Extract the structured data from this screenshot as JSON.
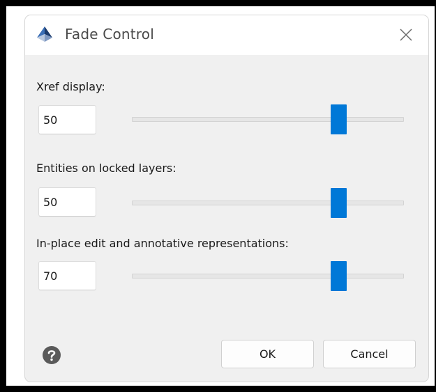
{
  "window": {
    "title": "Fade Control"
  },
  "fields": [
    {
      "label": "Xref display:",
      "value": "50"
    },
    {
      "label": "Entities on locked layers:",
      "value": "50"
    },
    {
      "label": "In-place edit and annotative representations:",
      "value": "70"
    }
  ],
  "slider_positions": [
    0.76,
    0.76,
    0.76
  ],
  "buttons": {
    "ok": "OK",
    "cancel": "Cancel"
  },
  "icons": {
    "app": "autocad-logo-icon",
    "close": "close-icon",
    "help": "help-icon"
  },
  "colors": {
    "accent": "#0078d7",
    "dialog_bg": "#f0f0f0",
    "titlebar_bg": "#ffffff"
  }
}
